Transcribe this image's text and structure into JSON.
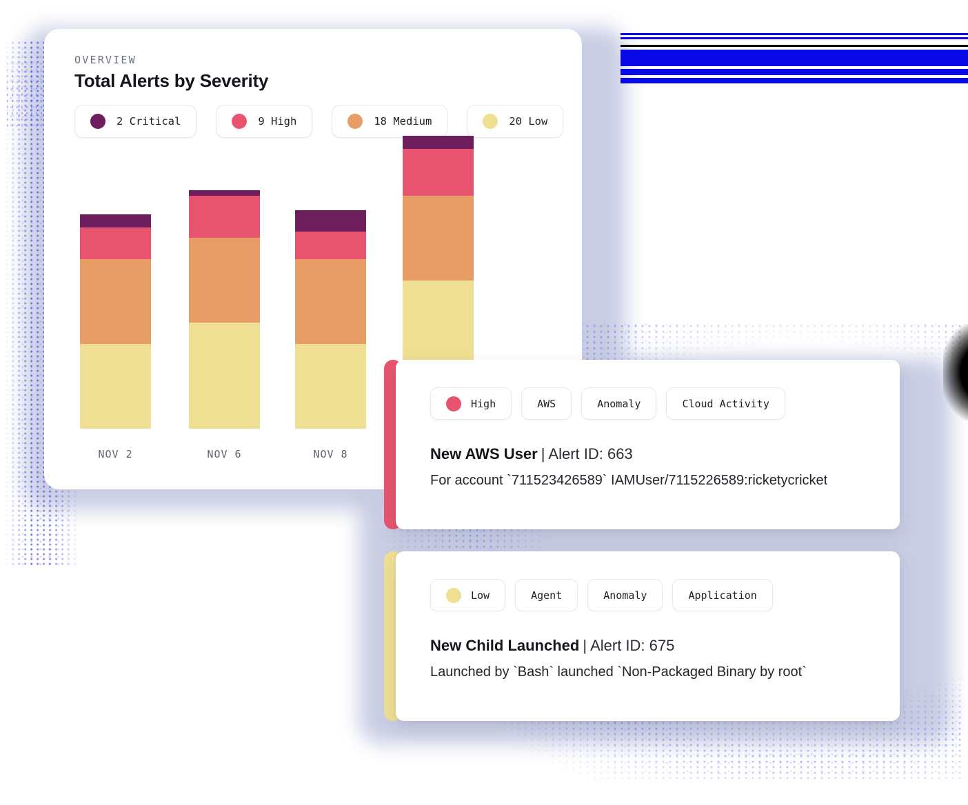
{
  "theme": {
    "critical_color": "#6e1e5c",
    "high_color": "#e8546f",
    "medium_color": "#e89c66",
    "low_color": "#efdf93",
    "background": "#c6cbe2",
    "card_background": "#ffffff",
    "text_primary": "#15161c",
    "text_muted": "#6b7180"
  },
  "overview": {
    "eyebrow": "OVERVIEW",
    "title": "Total Alerts by Severity",
    "legend": [
      {
        "label": "2 Critical",
        "count": 2,
        "severity": "Critical",
        "color": "#6e1e5c",
        "icon": "severity-dot-critical"
      },
      {
        "label": "9 High",
        "count": 9,
        "severity": "High",
        "color": "#e8546f",
        "icon": "severity-dot-high"
      },
      {
        "label": "18 Medium",
        "count": 18,
        "severity": "Medium",
        "color": "#e89c66",
        "icon": "severity-dot-medium"
      },
      {
        "label": "20 Low",
        "count": 20,
        "severity": "Low",
        "color": "#efdf93",
        "icon": "severity-dot-low"
      }
    ]
  },
  "chart_data": {
    "type": "bar",
    "title": "Total Alerts by Severity",
    "subtitle": "OVERVIEW",
    "stacked": true,
    "xlabel": "",
    "ylabel": "",
    "grid": false,
    "legend_position": "top",
    "ylim": [
      0,
      13
    ],
    "categories": [
      "NOV 2",
      "NOV 6",
      "NOV 8",
      ""
    ],
    "tick_labels": [
      "NOV 2",
      "NOV 6",
      "NOV 8"
    ],
    "series": [
      {
        "name": "Low",
        "color": "#efdf93",
        "values": [
          4,
          5,
          4,
          7
        ]
      },
      {
        "name": "Medium",
        "color": "#e89c66",
        "values": [
          4,
          4,
          4,
          4
        ]
      },
      {
        "name": "High",
        "color": "#e8546f",
        "values": [
          1.5,
          2,
          1.3,
          2.2
        ]
      },
      {
        "name": "Critical",
        "color": "#6e1e5c",
        "values": [
          0.6,
          0.25,
          1,
          0.6
        ]
      }
    ],
    "totals": [
      10.1,
      11.25,
      10.3,
      13.8
    ]
  },
  "alerts": [
    {
      "severity": "High",
      "accent_color": "#e8546f",
      "tags": [
        {
          "label": "High",
          "dot": true,
          "dot_color": "#e8546f",
          "icon": "severity-dot-high"
        },
        {
          "label": "AWS",
          "dot": false
        },
        {
          "label": "Anomaly",
          "dot": false
        },
        {
          "label": "Cloud Activity",
          "dot": false
        }
      ],
      "title_name": "New AWS User",
      "title_separator": "|",
      "title_id": "Alert ID: 663",
      "description": "For account `711523426589`   IAMUser/7115226589:ricketycricket"
    },
    {
      "severity": "Low",
      "accent_color": "#efdf93",
      "tags": [
        {
          "label": "Low",
          "dot": true,
          "dot_color": "#efdf93",
          "icon": "severity-dot-low"
        },
        {
          "label": "Agent",
          "dot": false
        },
        {
          "label": "Anomaly",
          "dot": false
        },
        {
          "label": "Application",
          "dot": false
        }
      ],
      "title_name": "New Child Launched",
      "title_separator": "|",
      "title_id": "Alert ID: 675",
      "description": "Launched by `Bash`   launched `Non-Packaged Binary by root`"
    }
  ]
}
